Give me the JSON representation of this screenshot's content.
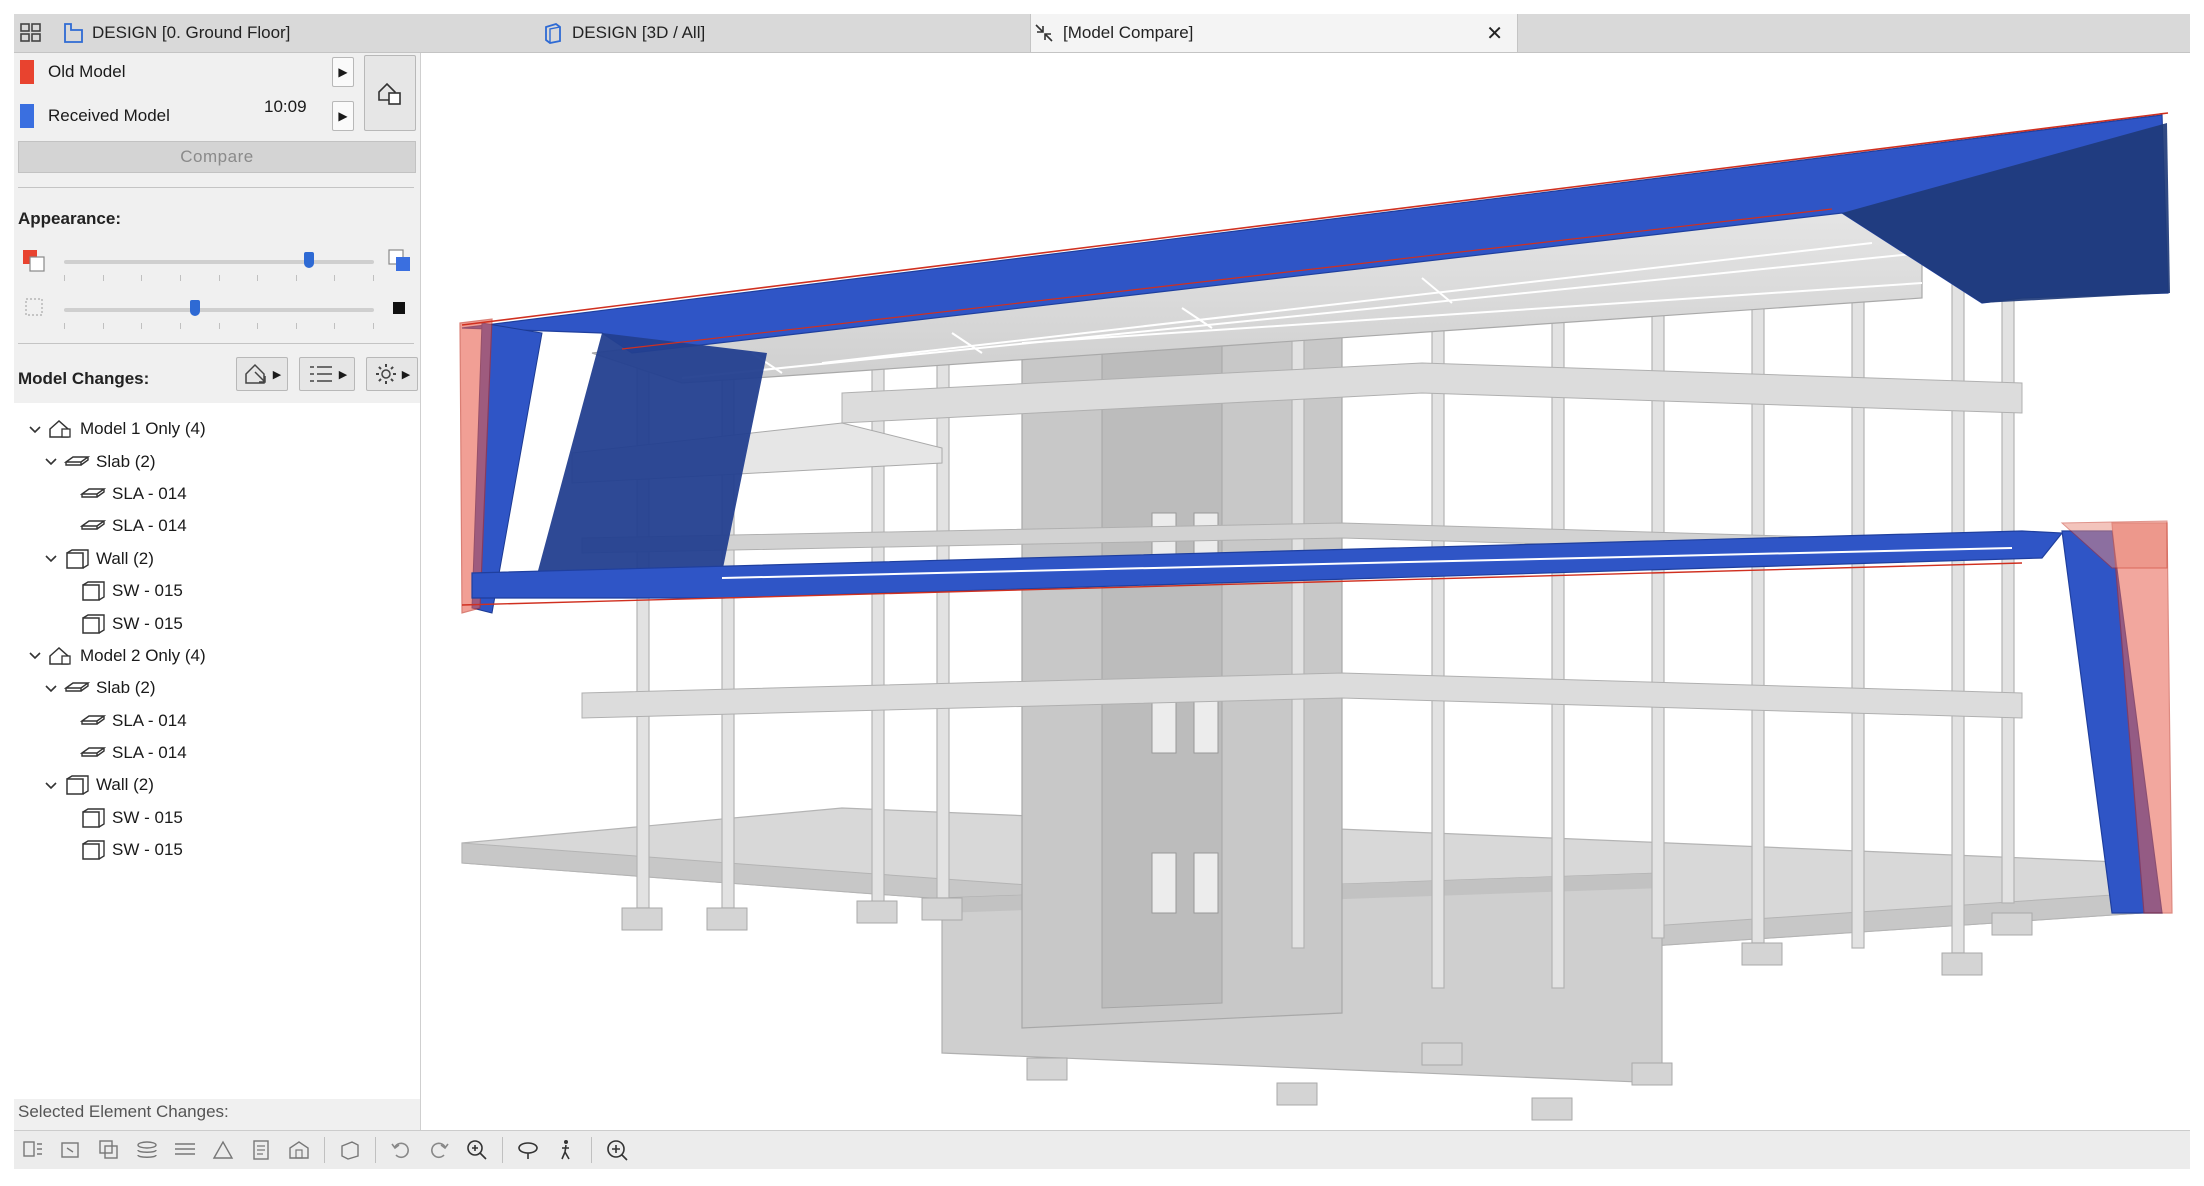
{
  "tabs": [
    {
      "label": "DESIGN [0. Ground Floor]",
      "icon": "floor-plan-icon",
      "active": false
    },
    {
      "label": "DESIGN [3D / All]",
      "icon": "3d-window-icon",
      "active": false
    },
    {
      "label": "[Model Compare]",
      "icon": "model-compare-icon",
      "active": true,
      "close": "✕"
    }
  ],
  "compare": {
    "old_label": "Old Model",
    "received_label": "Received Model",
    "time": "10:09",
    "old_color": "#e8432f",
    "received_color": "#3a6fe0",
    "compare_button": "Compare"
  },
  "appearance": {
    "title": "Appearance:",
    "opacity_level": 0.8,
    "transparency_level": 0.42
  },
  "model_changes": {
    "title": "Model Changes:",
    "tree": [
      {
        "label": "Model 1 Only (4)",
        "level": 0,
        "icon": "house-icon",
        "caret": true
      },
      {
        "label": "Slab (2)",
        "level": 1,
        "icon": "slab-icon",
        "caret": true
      },
      {
        "label": "SLA - 014",
        "level": 2,
        "icon": "slab-icon",
        "caret": false
      },
      {
        "label": "SLA - 014",
        "level": 2,
        "icon": "slab-icon",
        "caret": false
      },
      {
        "label": "Wall (2)",
        "level": 1,
        "icon": "wall-icon",
        "caret": true
      },
      {
        "label": "SW - 015",
        "level": 2,
        "icon": "wall-icon",
        "caret": false
      },
      {
        "label": "SW - 015",
        "level": 2,
        "icon": "wall-icon",
        "caret": false
      },
      {
        "label": "Model 2 Only (4)",
        "level": 0,
        "icon": "house-icon",
        "caret": true
      },
      {
        "label": "Slab (2)",
        "level": 1,
        "icon": "slab-icon",
        "caret": true
      },
      {
        "label": "SLA - 014",
        "level": 2,
        "icon": "slab-icon",
        "caret": false
      },
      {
        "label": "SLA - 014",
        "level": 2,
        "icon": "slab-icon",
        "caret": false
      },
      {
        "label": "Wall (2)",
        "level": 1,
        "icon": "wall-icon",
        "caret": true
      },
      {
        "label": "SW - 015",
        "level": 2,
        "icon": "wall-icon",
        "caret": false
      },
      {
        "label": "SW - 015",
        "level": 2,
        "icon": "wall-icon",
        "caret": false
      }
    ]
  },
  "selected_changes": {
    "title": "Selected Element Changes:"
  },
  "colors": {
    "tabbar": "#d9d9d9",
    "panel": "#f0f0f0",
    "accent": "#2e6ad4",
    "old": "#e8432f",
    "new": "#2f55c6"
  }
}
